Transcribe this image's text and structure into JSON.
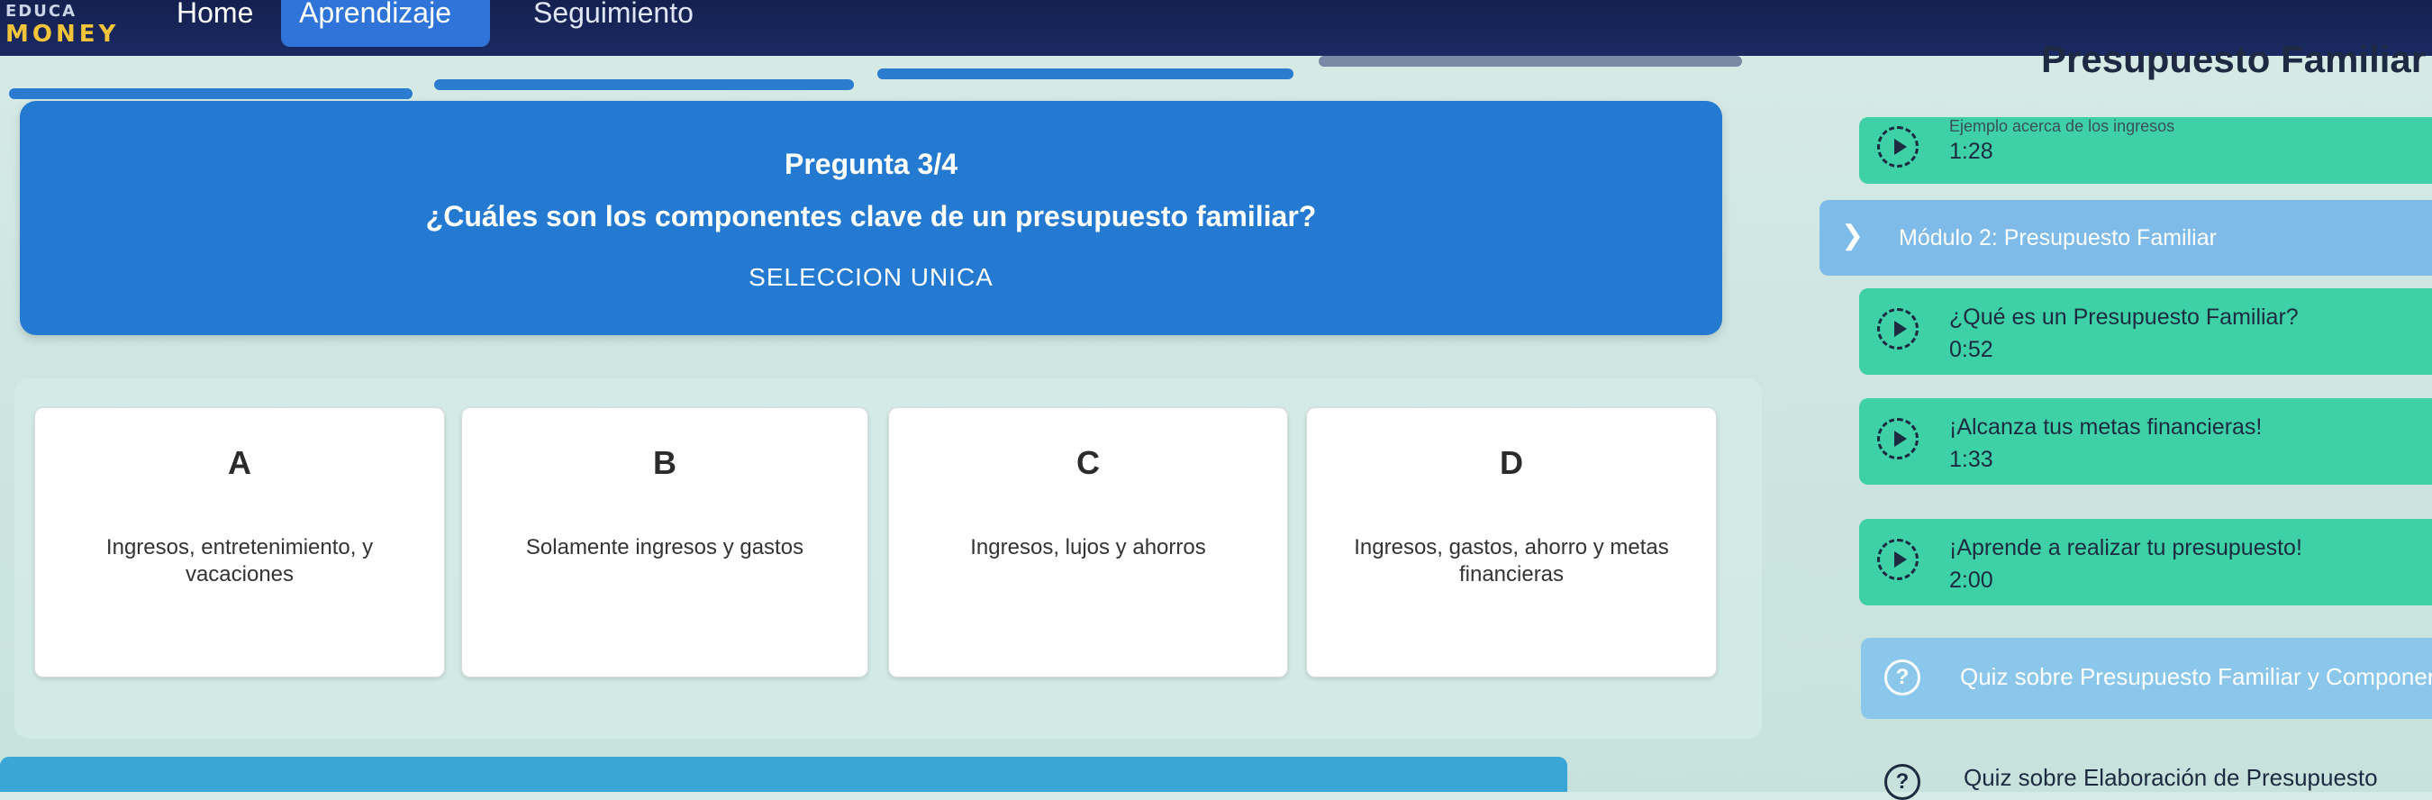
{
  "nav": {
    "logo_text": "MONEY",
    "logo_top": "EDUCA",
    "home": "Home",
    "aprendizaje": "Aprendizaje",
    "seguimiento": "Seguimiento"
  },
  "question": {
    "number": "Pregunta 3/4",
    "text": "¿Cuáles son los componentes clave de un presupuesto familiar?",
    "type": "SELECCION UNICA"
  },
  "options": [
    {
      "letter": "A",
      "text": "Ingresos, entretenimiento, y vacaciones"
    },
    {
      "letter": "B",
      "text": "Solamente ingresos y gastos"
    },
    {
      "letter": "C",
      "text": "Ingresos, lujos y ahorros"
    },
    {
      "letter": "D",
      "text": "Ingresos, gastos, ahorro y metas financieras"
    }
  ],
  "sidebar": {
    "title": "Presupuesto Familiar",
    "lessons": [
      {
        "title": "Ejemplo acerca de los ingresos",
        "time": "1:28"
      },
      {
        "title": "¿Qué es un Presupuesto Familiar?",
        "time": "0:52"
      },
      {
        "title": "¡Alcanza tus metas financieras!",
        "time": "1:33"
      },
      {
        "title": "¡Aprende a realizar tu presupuesto!",
        "time": "2:00"
      }
    ],
    "module": "Módulo 2: Presupuesto Familiar",
    "quizzes": [
      {
        "title": "Quiz sobre Presupuesto Familiar y Componentes"
      },
      {
        "title": "Quiz sobre Elaboración de Presupuesto"
      }
    ]
  },
  "colors": {
    "primary": "#2479d1",
    "lesson": "#3ed1a7",
    "nav": "#14204f",
    "module": "#7fbbe8"
  }
}
